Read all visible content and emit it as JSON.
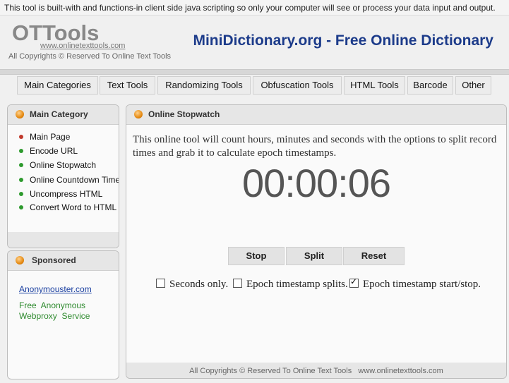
{
  "notice": "This tool is built-with and functions-in client side java scripting so only your computer will see or process your data input and output.",
  "logo": {
    "title": "OTTools",
    "url": "www.onlinetexttools.com",
    "copyright": "All Copyrights © Reserved To Online Text Tools"
  },
  "site_title": "MiniDictionary.org - Free Online Dictionary",
  "nav": [
    "Main Categories",
    "Text Tools",
    "Randomizing Tools",
    "Obfuscation Tools",
    "HTML Tools",
    "Barcode",
    "Other"
  ],
  "sidebar": {
    "title": "Main Category",
    "items": [
      {
        "label": "Main Page",
        "bullet": "#c0392b"
      },
      {
        "label": "Encode URL",
        "bullet": "#2e9a2e"
      },
      {
        "label": "Online Stopwatch",
        "bullet": "#2e9a2e"
      },
      {
        "label": "Online Countdown Time",
        "bullet": "#2e9a2e"
      },
      {
        "label": "Uncompress HTML",
        "bullet": "#2e9a2e"
      },
      {
        "label": "Convert Word to HTML",
        "bullet": "#2e9a2e"
      }
    ]
  },
  "sponsored": {
    "title": "Sponsored",
    "link": "Anonymouster.com",
    "text_line1": "Free  Anonymous",
    "text_line2": "Webproxy  Service"
  },
  "main": {
    "title": "Online Stopwatch",
    "description": "This online tool will count hours, minutes and seconds with the options to split record times and grab it to calculate epoch timestamps.",
    "clock": "00:00:06",
    "buttons": {
      "stop": "Stop",
      "split": "Split",
      "reset": "Reset"
    },
    "options": [
      {
        "label": "Seconds only.",
        "checked": false
      },
      {
        "label": "Epoch timestamp splits.",
        "checked": false
      },
      {
        "label": "Epoch timestamp start/stop.",
        "checked": true
      }
    ],
    "footer": "All Copyrights © Reserved To Online Text Tools   www.onlinetexttools.com"
  }
}
